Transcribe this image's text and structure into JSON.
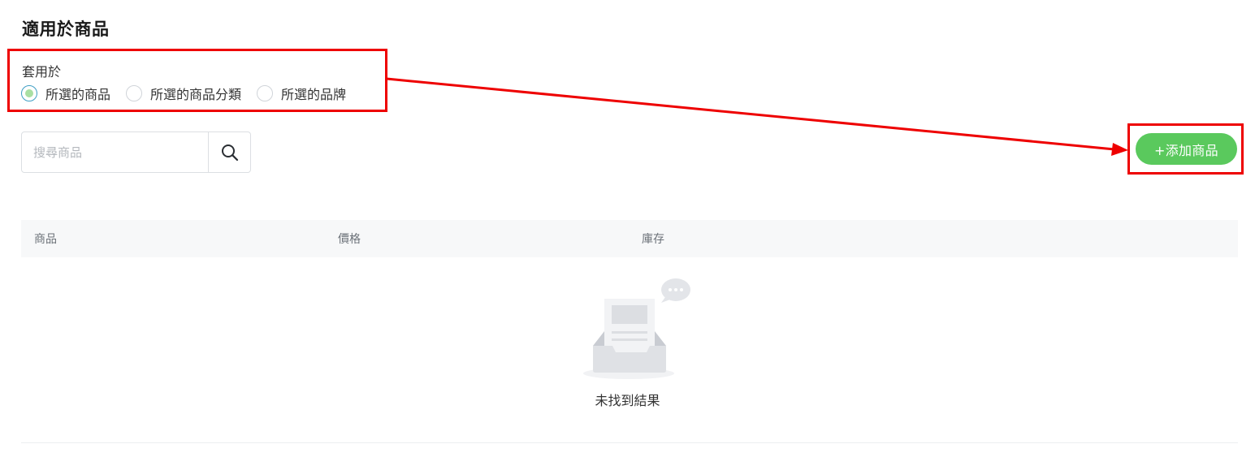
{
  "section": {
    "title": "適用於商品"
  },
  "apply": {
    "label": "套用於",
    "options": [
      {
        "label": "所選的商品",
        "checked": true
      },
      {
        "label": "所選的商品分類",
        "checked": false
      },
      {
        "label": "所選的品牌",
        "checked": false
      }
    ]
  },
  "search": {
    "placeholder": "搜尋商品",
    "icon": "search-icon"
  },
  "add_button": {
    "label": "+添加商品",
    "color": "#5ac95d"
  },
  "table": {
    "columns": [
      "商品",
      "價格",
      "庫存"
    ]
  },
  "empty_state": {
    "text": "未找到結果",
    "icon": "empty-inbox-icon"
  },
  "annotation": {
    "color": "#ee0000"
  }
}
